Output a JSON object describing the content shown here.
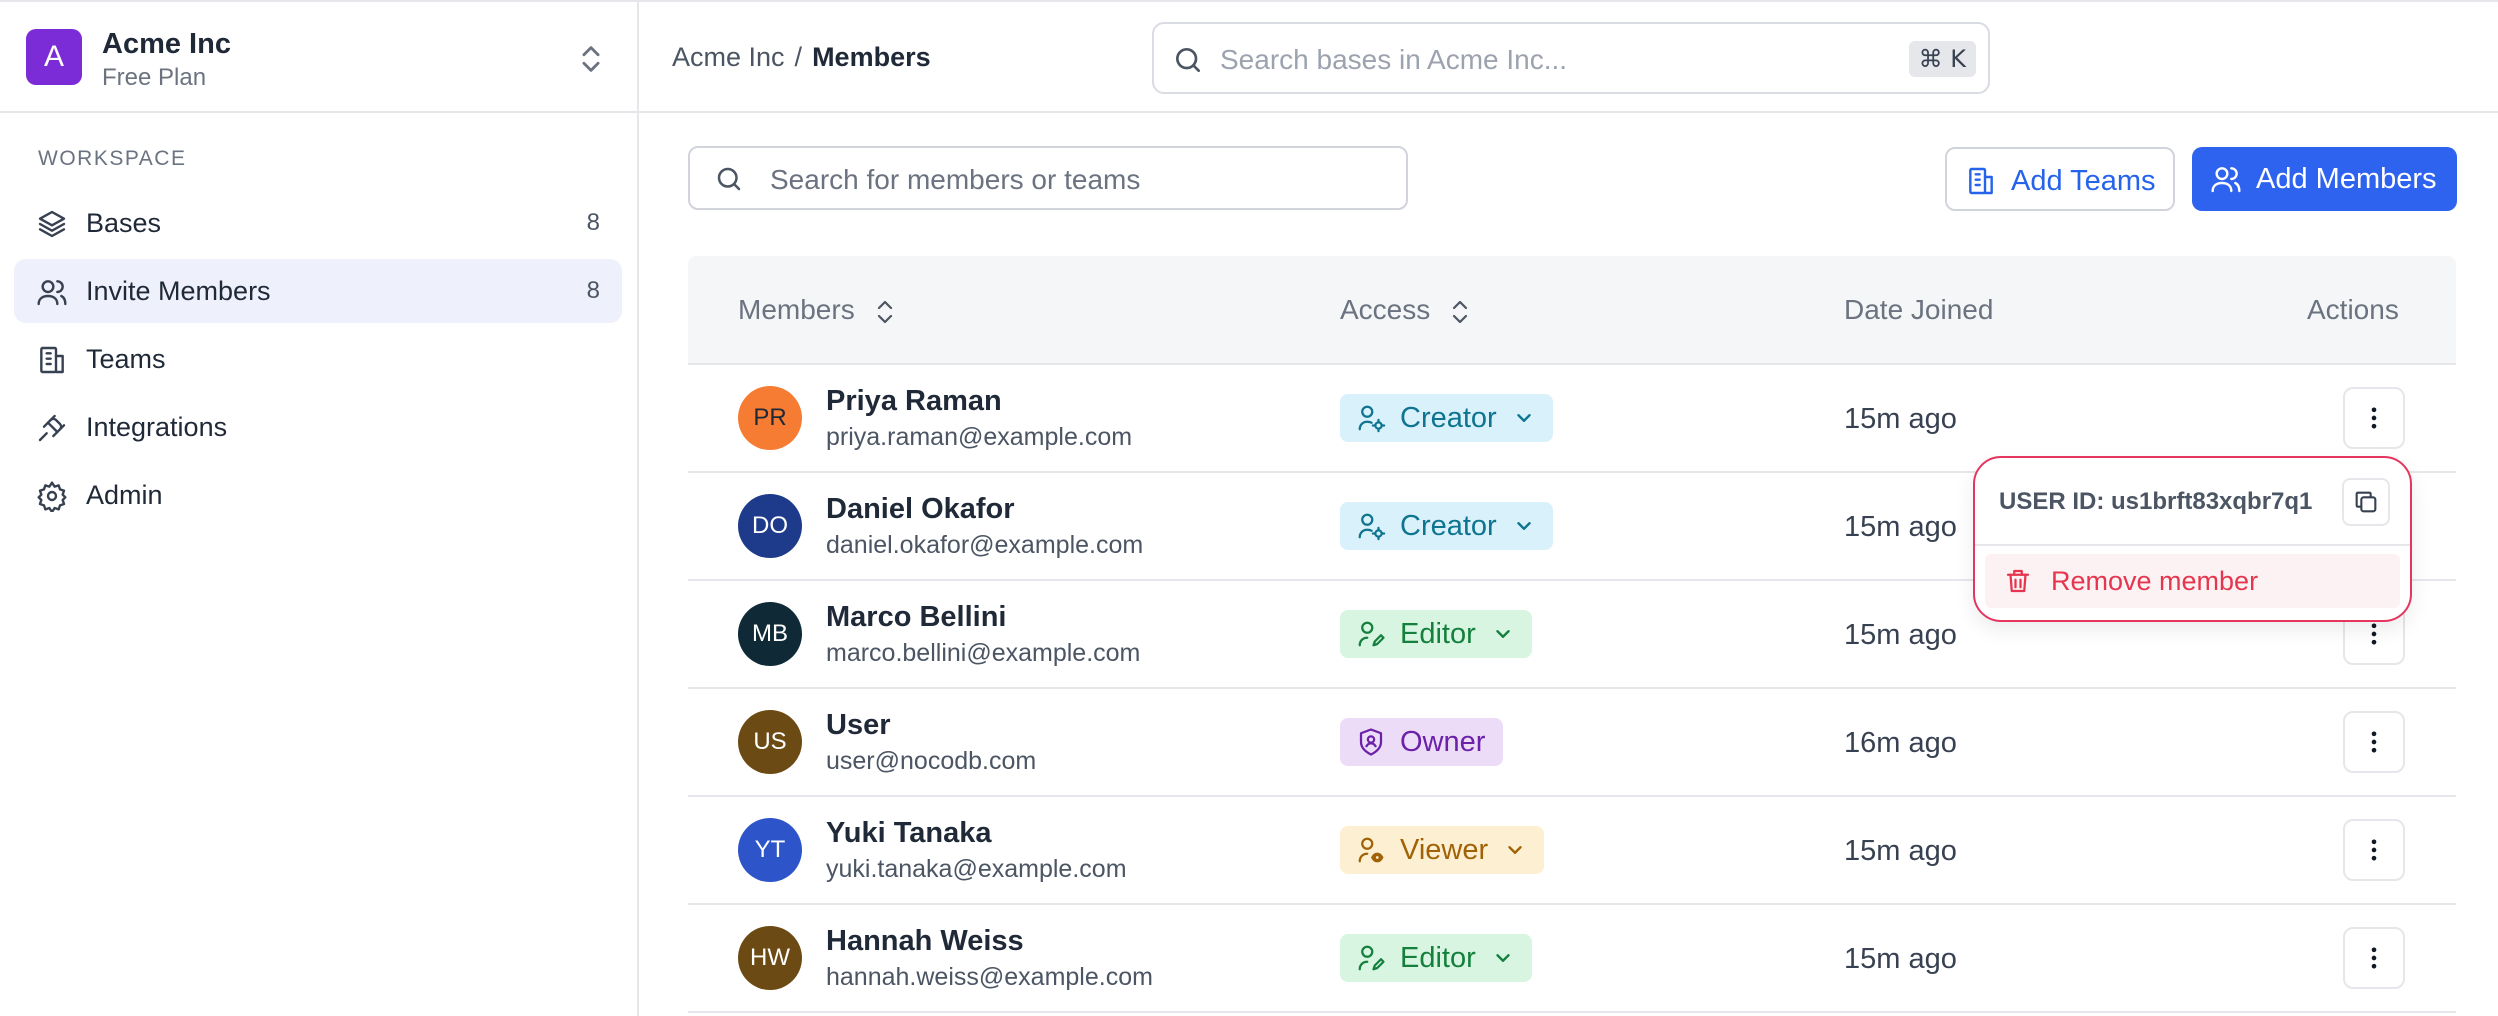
{
  "workspace": {
    "initial": "A",
    "name": "Acme Inc",
    "plan": "Free Plan"
  },
  "sidebar": {
    "section": "WORKSPACE",
    "items": [
      {
        "label": "Bases",
        "icon": "layers-icon",
        "count": "8"
      },
      {
        "label": "Invite Members",
        "icon": "users-icon",
        "count": "8",
        "active": true
      },
      {
        "label": "Teams",
        "icon": "building-icon",
        "count": ""
      },
      {
        "label": "Integrations",
        "icon": "plug-icon",
        "count": ""
      },
      {
        "label": "Admin",
        "icon": "gear-icon",
        "count": ""
      }
    ]
  },
  "breadcrumb": {
    "root": "Acme Inc",
    "separator": "/",
    "current": "Members"
  },
  "global_search": {
    "placeholder": "Search bases in Acme Inc...",
    "shortcut": "⌘ K"
  },
  "member_search": {
    "placeholder": "Search for members or teams"
  },
  "actions": {
    "add_teams": "Add Teams",
    "add_members": "Add Members"
  },
  "table": {
    "headers": {
      "members": "Members",
      "access": "Access",
      "date": "Date Joined",
      "actions": "Actions"
    },
    "rows": [
      {
        "initials": "PR",
        "avatar_color": "#f57c32",
        "avatar_text": "#1f2937",
        "name": "Priya Raman",
        "email": "priya.raman@example.com",
        "role": "Creator",
        "role_type": "creator",
        "editable": true,
        "date": "15m ago"
      },
      {
        "initials": "DO",
        "avatar_color": "#1e3a8a",
        "avatar_text": "#ffffff",
        "name": "Daniel Okafor",
        "email": "daniel.okafor@example.com",
        "role": "Creator",
        "role_type": "creator",
        "editable": true,
        "date": "15m ago"
      },
      {
        "initials": "MB",
        "avatar_color": "#0f2a36",
        "avatar_text": "#ffffff",
        "name": "Marco Bellini",
        "email": "marco.bellini@example.com",
        "role": "Editor",
        "role_type": "editor",
        "editable": true,
        "date": "15m ago"
      },
      {
        "initials": "US",
        "avatar_color": "#6b4a14",
        "avatar_text": "#ffffff",
        "name": "User",
        "email": "user@nocodb.com",
        "role": "Owner",
        "role_type": "owner",
        "editable": false,
        "date": "16m ago"
      },
      {
        "initials": "YT",
        "avatar_color": "#2d55c9",
        "avatar_text": "#ffffff",
        "name": "Yuki Tanaka",
        "email": "yuki.tanaka@example.com",
        "role": "Viewer",
        "role_type": "viewer",
        "editable": true,
        "date": "15m ago"
      },
      {
        "initials": "HW",
        "avatar_color": "#6b4a14",
        "avatar_text": "#ffffff",
        "name": "Hannah Weiss",
        "email": "hannah.weiss@example.com",
        "role": "Editor",
        "role_type": "editor",
        "editable": true,
        "date": "15m ago"
      }
    ]
  },
  "menu": {
    "user_id": "USER ID: us1brft83xqbr7q1",
    "remove": "Remove member"
  },
  "colors": {
    "accent": "#2e63f0",
    "danger": "#e5364f",
    "workspace": "#7b2cd6"
  }
}
